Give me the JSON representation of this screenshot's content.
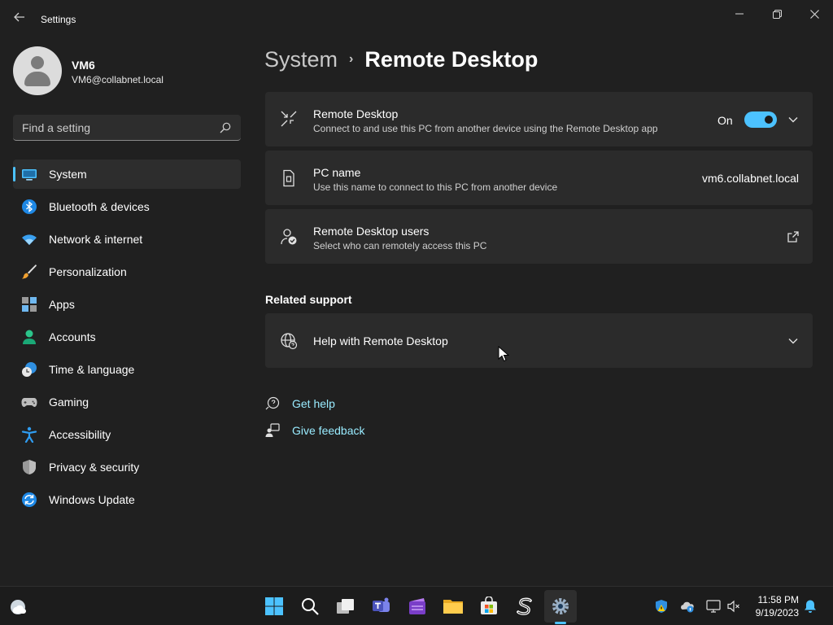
{
  "window": {
    "title": "Settings"
  },
  "profile": {
    "name": "VM6",
    "email": "VM6@collabnet.local"
  },
  "search": {
    "placeholder": "Find a setting"
  },
  "sidebar": {
    "items": [
      {
        "label": "System",
        "icon": "system-icon",
        "selected": true
      },
      {
        "label": "Bluetooth & devices",
        "icon": "bluetooth-icon"
      },
      {
        "label": "Network & internet",
        "icon": "wifi-icon"
      },
      {
        "label": "Personalization",
        "icon": "brush-icon"
      },
      {
        "label": "Apps",
        "icon": "apps-icon"
      },
      {
        "label": "Accounts",
        "icon": "accounts-icon"
      },
      {
        "label": "Time & language",
        "icon": "clock-globe-icon"
      },
      {
        "label": "Gaming",
        "icon": "gamepad-icon"
      },
      {
        "label": "Accessibility",
        "icon": "accessibility-icon"
      },
      {
        "label": "Privacy & security",
        "icon": "shield-icon"
      },
      {
        "label": "Windows Update",
        "icon": "update-icon"
      }
    ]
  },
  "breadcrumb": {
    "parent": "System",
    "separator": "›",
    "current": "Remote Desktop"
  },
  "cards": {
    "remote_desktop": {
      "title": "Remote Desktop",
      "description": "Connect to and use this PC from another device using the Remote Desktop app",
      "toggle_label": "On",
      "toggle_on": true
    },
    "pc_name": {
      "title": "PC name",
      "description": "Use this name to connect to this PC from another device",
      "value": "vm6.collabnet.local"
    },
    "users": {
      "title": "Remote Desktop users",
      "description": "Select who can remotely access this PC"
    }
  },
  "related": {
    "title": "Related support",
    "help": {
      "title": "Help with Remote Desktop"
    }
  },
  "links": {
    "get_help": "Get help",
    "give_feedback": "Give feedback"
  },
  "taskbar": {
    "time": "11:58 PM",
    "date": "9/19/2023"
  },
  "colors": {
    "accent": "#4cc2ff",
    "background": "#202020",
    "card": "#2b2b2b",
    "link": "#99ebff"
  }
}
